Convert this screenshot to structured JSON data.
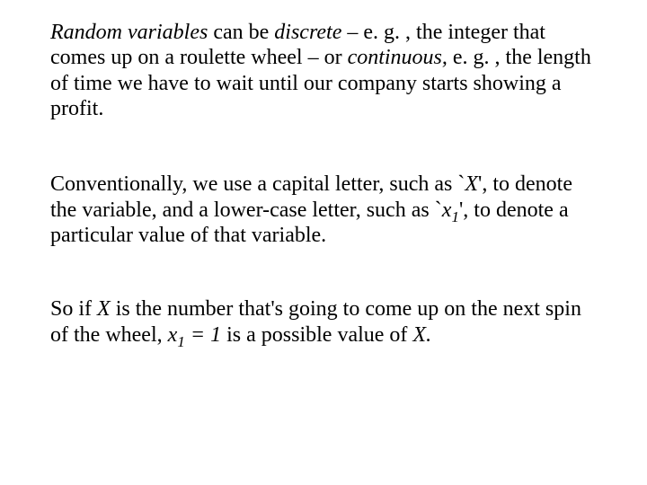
{
  "para1": {
    "t1": "Random variables",
    "t2": " can be ",
    "t3": "discrete",
    "t4": " – e. g. , the integer that comes up on a roulette wheel – or  ",
    "t5": "continuous,",
    "t6": " e. g. ,  the length of time we have to wait until our company starts showing a profit."
  },
  "para2": {
    "t1": "Conventionally, we use a capital letter, such as `",
    "t2": "X",
    "t3": "', to denote the variable, and a lower-case letter, such as `",
    "t4": "x",
    "t5": "1",
    "t6": "', to denote a particular value of that variable."
  },
  "para3": {
    "t1": "So if ",
    "t2": "X",
    "t3": " is the number that's going to come up on the next spin of the wheel, ",
    "t4": "x",
    "t5": "1",
    "t6": " = 1",
    "t7": " is a possible value of ",
    "t8": "X.",
    "t9": ""
  }
}
